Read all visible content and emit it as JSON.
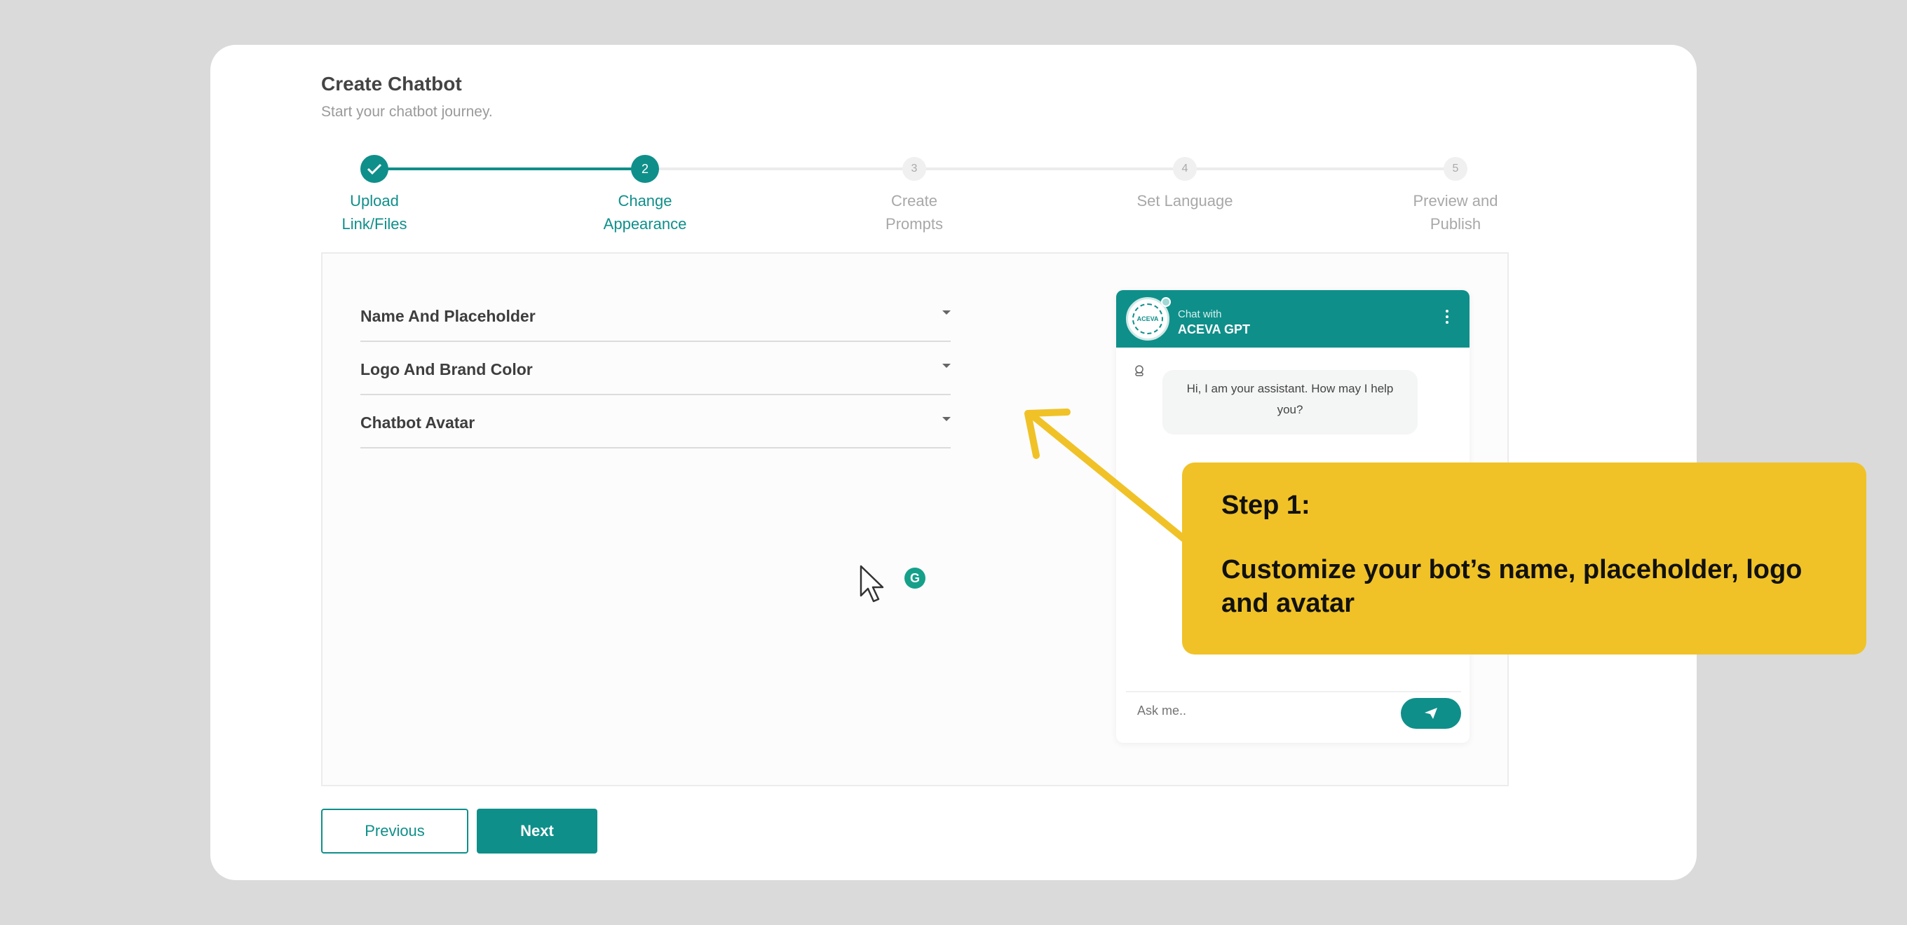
{
  "header": {
    "title": "Create Chatbot",
    "subtitle": "Start your chatbot journey."
  },
  "stepper": {
    "steps": [
      {
        "number": "",
        "label_line1": "Upload",
        "label_line2": "Link/Files",
        "status": "done"
      },
      {
        "number": "2",
        "label_line1": "Change",
        "label_line2": "Appearance",
        "status": "active"
      },
      {
        "number": "3",
        "label_line1": "Create",
        "label_line2": "Prompts",
        "status": "todo"
      },
      {
        "number": "4",
        "label_line1": "Set Language",
        "label_line2": "",
        "status": "todo"
      },
      {
        "number": "5",
        "label_line1": "Preview and",
        "label_line2": "Publish",
        "status": "todo"
      }
    ]
  },
  "accordion": {
    "items": [
      {
        "label": "Name And Placeholder"
      },
      {
        "label": "Logo And Brand Color"
      },
      {
        "label": "Chatbot Avatar"
      }
    ]
  },
  "chat_preview": {
    "chat_with": "Chat with",
    "bot_name": "ACEVA GPT",
    "logo_text": "ACEVA",
    "greeting": "Hi, I am your assistant. How may I help you?",
    "input_placeholder": "Ask me.."
  },
  "buttons": {
    "previous": "Previous",
    "next": "Next"
  },
  "grammarly_badge": "G",
  "callout": {
    "title": "Step 1:",
    "body": "Customize your bot’s name, placeholder, logo and avatar"
  },
  "colors": {
    "brand": "#0f8f8a",
    "callout": "#f0c227",
    "background": "#dadada"
  }
}
